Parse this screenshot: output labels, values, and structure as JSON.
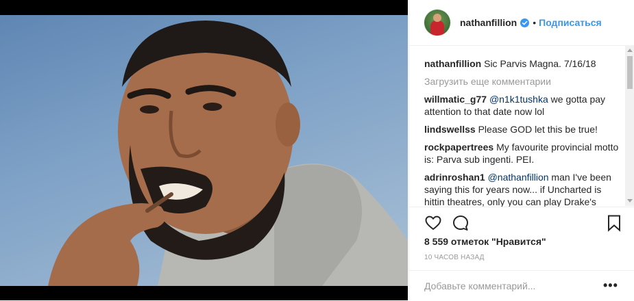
{
  "header": {
    "username": "nathanfillion",
    "separator": "•",
    "follow_label": "Подписаться"
  },
  "caption": {
    "user": "nathanfillion",
    "text": "Sic Parvis Magna. 7/16/18"
  },
  "load_more_label": "Загрузить еще комментарии",
  "comments": [
    {
      "user": "willmatic_g77",
      "mention": "@n1k1tushka",
      "text": " we gotta pay attention to that date now lol"
    },
    {
      "user": "lindswellss",
      "mention": "",
      "text": "Please GOD let this be true!"
    },
    {
      "user": "rockpapertrees",
      "mention": "",
      "text": "My favourite provincial motto is: Parva sub ingenti. PEI."
    },
    {
      "user": "adrinroshan1",
      "mention": "@nathanfillion",
      "text": " man I've been saying this for years now... if Uncharted is hittin theatres, only you can play Drake's"
    }
  ],
  "likes_text": "8 559 отметок \"Нравится\"",
  "time_text": "10 ЧАСОВ НАЗАД",
  "add_comment_placeholder": "Добавьте комментарий...",
  "more_label": "•••",
  "icons": {
    "like": "heart-icon",
    "comment": "comment-bubble-icon",
    "save": "bookmark-icon",
    "verified": "verified-badge-icon"
  },
  "colors": {
    "link": "#3897f0",
    "mention": "#003569",
    "muted": "#999999",
    "text": "#262626"
  }
}
